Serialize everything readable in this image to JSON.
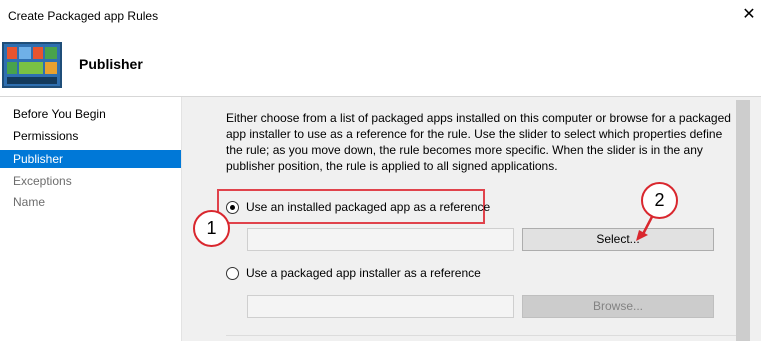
{
  "window": {
    "title": "Create Packaged app Rules",
    "close_glyph": "✕"
  },
  "header": {
    "heading": "Publisher",
    "icon": "app-tiles-icon"
  },
  "sidebar": {
    "items": [
      {
        "label": "Before You Begin",
        "state": "normal"
      },
      {
        "label": "Permissions",
        "state": "normal"
      },
      {
        "label": "Publisher",
        "state": "selected"
      },
      {
        "label": "Exceptions",
        "state": "disabled"
      },
      {
        "label": "Name",
        "state": "disabled"
      }
    ]
  },
  "main": {
    "description": "Either choose from a list of packaged apps installed on this computer or browse for a packaged app installer to use as a reference for the rule. Use the slider to select which properties define the rule; as you move down, the rule becomes more specific. When the slider is in the any publisher position, the rule is applied to all signed applications.",
    "option_installed": {
      "label": "Use an installed packaged app as a reference",
      "checked": true,
      "input_value": "",
      "button_label": "Select..."
    },
    "option_installer": {
      "label": "Use a packaged app installer as a reference",
      "checked": false,
      "input_value": "",
      "button_label": "Browse..."
    }
  },
  "annotations": {
    "callout_1": "1",
    "callout_2": "2",
    "accent_color": "#d9272e"
  },
  "colors": {
    "selection": "#0078d7",
    "highlight_red": "#e0424b"
  }
}
